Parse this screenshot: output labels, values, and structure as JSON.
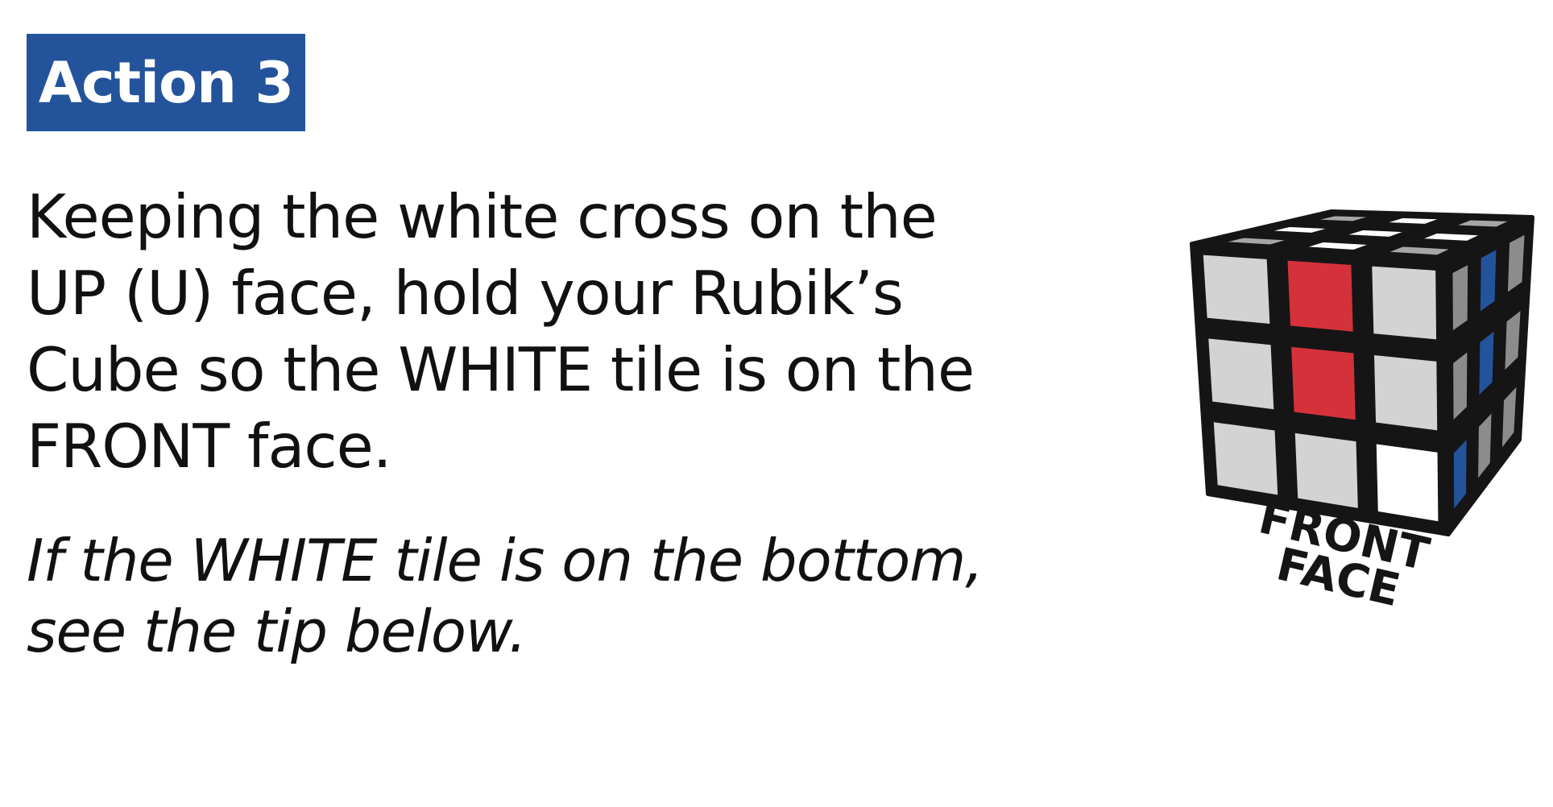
{
  "badge": {
    "label": "Action 3",
    "color": "#23549b"
  },
  "instruction": {
    "lines": [
      "Keeping the white cross on the",
      "UP (U) face, hold your Rubik’s",
      "Cube so the WHITE tile is on the",
      "FRONT face."
    ]
  },
  "tip": {
    "lines": [
      "If the WHITE tile is on the bottom,",
      "see the tip below."
    ]
  },
  "cube": {
    "label_line1": "FRONT",
    "label_line2": "FACE",
    "colors": {
      "outline": "#151515",
      "grey": "#d3d3d3",
      "white": "#ffffff",
      "red": "#d4313a",
      "blue": "#23549b",
      "side_grey": "#8c8c8c",
      "top_grey": "#a6a6a6"
    }
  }
}
